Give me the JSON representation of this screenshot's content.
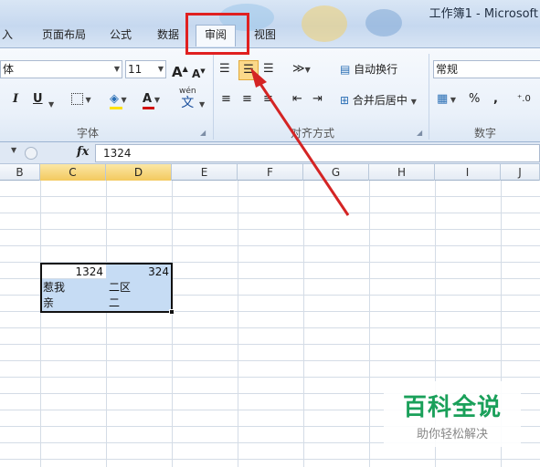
{
  "window": {
    "title": "工作簿1 - Microsoft"
  },
  "tabs": [
    {
      "label": "插入",
      "partial": "入"
    },
    {
      "label": "页面布局"
    },
    {
      "label": "公式"
    },
    {
      "label": "数据"
    },
    {
      "label": "审阅",
      "active": true
    },
    {
      "label": "视图"
    }
  ],
  "ribbon": {
    "font": {
      "name_value": "体",
      "size_value": "11",
      "grow_glyph": "A",
      "shrink_glyph": "A",
      "italic": "I",
      "underline": "U",
      "color_glyph": "A",
      "wen_glyph": "wén",
      "wen_char": "文",
      "group_label": "字体"
    },
    "alignment": {
      "wrap_label": "自动换行",
      "merge_label": "合并后居中",
      "group_label": "对齐方式"
    },
    "number": {
      "format_value": "常规",
      "percent": "%",
      "comma": ",",
      "group_label": "数字"
    }
  },
  "formula_bar": {
    "fx": "fx",
    "value": "1324"
  },
  "columns": [
    "B",
    "C",
    "D",
    "E",
    "F",
    "G",
    "H",
    "I",
    "J"
  ],
  "selected_columns": [
    "C",
    "D"
  ],
  "cells": {
    "c1": "1324",
    "d1": "324",
    "c2": "惹我",
    "d2": "二区",
    "c3": "亲",
    "d3": "二"
  },
  "colors": {
    "annotation": "#e02020",
    "selection_fill": "#c6dcf4",
    "watermark": "#1aa05a"
  },
  "watermark": {
    "title": "百科全说",
    "subtitle": "助你轻松解决"
  }
}
